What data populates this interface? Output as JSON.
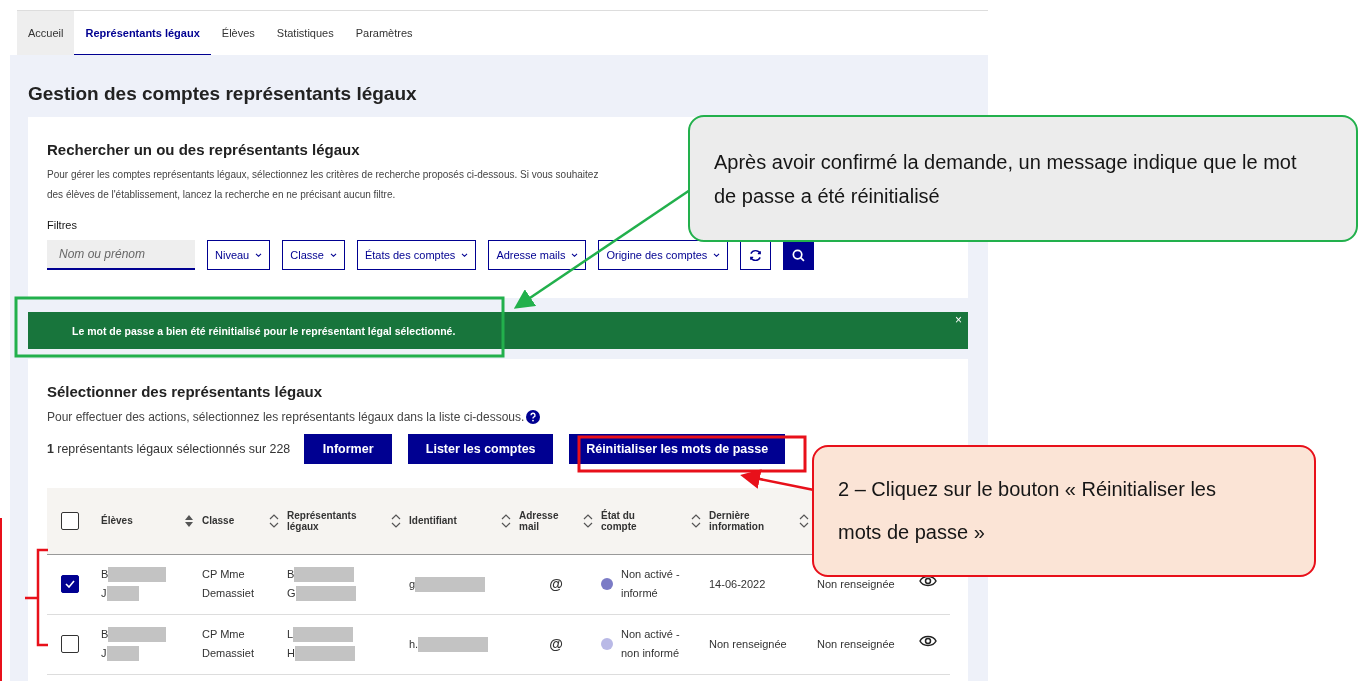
{
  "tabs": [
    {
      "label": "Accueil",
      "selected": false
    },
    {
      "label": "Représentants légaux",
      "selected": true
    },
    {
      "label": "Élèves",
      "selected": false
    },
    {
      "label": "Statistiques",
      "selected": false
    },
    {
      "label": "Paramètres",
      "selected": false
    }
  ],
  "page_title": "Gestion des comptes représentants légaux",
  "search": {
    "title": "Rechercher un ou des représentants légaux",
    "description": [
      "Pour gérer les comptes représentants légaux, sélectionnez les critères de recherche proposés ci-dessous. Si vous souhaitez",
      "des élèves de l'établissement, lancez la recherche en ne précisant aucun filtre."
    ],
    "filters_label": "Filtres",
    "name_field": {
      "placeholder": "Nom ou prénom"
    },
    "dropdowns": [
      "Niveau",
      "Classe",
      "États des comptes",
      "Adresse mails",
      "Origine des comptes"
    ]
  },
  "alert": {
    "message": "Le mot de passe a bien été réinitialisé pour le représentant légal sélectionné.",
    "close": "×"
  },
  "selection": {
    "title": "Sélectionner des représentants légaux",
    "help": "Pour effectuer des actions, sélectionnez les représentants légaux dans la liste ci-dessous.",
    "count": "**1** représentants légaux sélectionnés sur 228",
    "buttons": [
      "Informer",
      "Lister les comptes",
      "Réinitialiser les mots de passe"
    ]
  },
  "table": {
    "all_checked": false,
    "columns": [
      {
        "label": "Élèves",
        "sorted": true
      },
      {
        "label": "Classe",
        "sorted": false
      },
      {
        "label": "Représentants légaux",
        "sorted": false
      },
      {
        "label": "Identifiant",
        "sorted": false
      },
      {
        "label": "Adresse mail",
        "sorted": false
      },
      {
        "label": "État du compte",
        "sorted": false
      },
      {
        "label": "Dernière information",
        "sorted": false
      }
    ],
    "rows": [
      {
        "checked": true,
        "eleve": [
          "B",
          "J"
        ],
        "classe": "CP Mme Demassiet",
        "representants": [
          "B",
          "G"
        ],
        "identifiant": "g",
        "mail": "@",
        "etat": "Non activé - informé",
        "color": "#7b7bc6",
        "derniere": "14-06-2022",
        "column_8": "Non renseignée"
      },
      {
        "checked": false,
        "eleve": [
          "B",
          "J"
        ],
        "classe": "CP Mme Demassiet",
        "representants": [
          "L",
          "H"
        ],
        "identifiant": "h.",
        "mail": "@",
        "etat": "Non activé - non informé",
        "color": "#b9b9e6",
        "derniere": "Non renseignée",
        "column_8": "Non renseignée"
      }
    ]
  },
  "callouts": [
    {
      "kind": "info",
      "text": "Après avoir confirmé la demande, un message indique que le mot de passe a été réinitialisé"
    },
    {
      "kind": "step",
      "text": "2 – Cliquez sur le bouton « Réinitialiser les mots de passe »"
    }
  ]
}
